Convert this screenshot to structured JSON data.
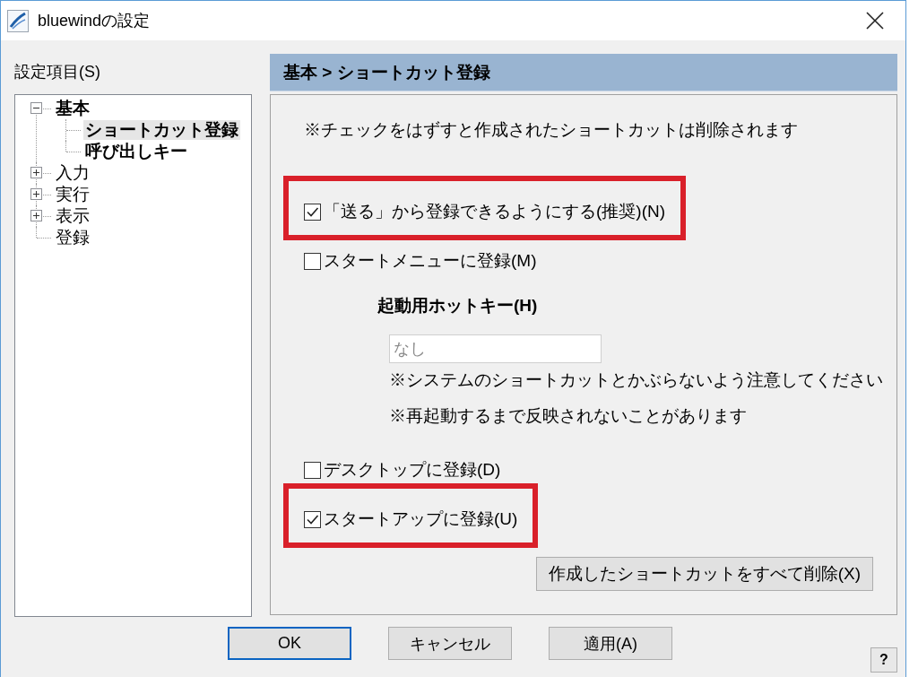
{
  "window": {
    "title": "bluewindの設定"
  },
  "sidebar": {
    "label": "設定項目(S)",
    "tree": [
      {
        "label": "基本",
        "expanded": true,
        "selected": false,
        "children": [
          {
            "label": "ショートカット登録",
            "selected": true
          },
          {
            "label": "呼び出しキー",
            "selected": false
          }
        ]
      },
      {
        "label": "入力",
        "expanded": false,
        "selected": false
      },
      {
        "label": "実行",
        "expanded": false,
        "selected": false
      },
      {
        "label": "表示",
        "expanded": false,
        "selected": false
      },
      {
        "label": "登録",
        "selected": false
      }
    ]
  },
  "panel": {
    "breadcrumb": "基本 > ショートカット登録",
    "notice": "※チェックをはずすと作成されたショートカットは削除されます",
    "controls": [
      {
        "kind": "checkbox",
        "label": "「送る」から登録できるようにする(推奨)(N)",
        "checked": true,
        "highlighted": true
      },
      {
        "kind": "checkbox",
        "label": "スタートメニューに登録(M)",
        "checked": false,
        "highlighted": false
      },
      {
        "kind": "hotkey",
        "heading": "起動用ホットキー(H)",
        "field": {
          "value": "なし",
          "disabled": true
        },
        "notes": [
          "※システムのショートカットとかぶらないよう注意してください",
          "※再起動するまで反映されないことがあります"
        ]
      },
      {
        "kind": "checkbox",
        "label": "デスクトップに登録(D)",
        "checked": false,
        "highlighted": false
      },
      {
        "kind": "checkbox",
        "label": "スタートアップに登録(U)",
        "checked": true,
        "highlighted": true
      }
    ],
    "delete_button": "作成したショートカットをすべて削除(X)"
  },
  "buttons": [
    {
      "label": "OK",
      "default": true
    },
    {
      "label": "キャンセル",
      "default": false
    },
    {
      "label": "適用(A)",
      "default": false
    }
  ],
  "help_button": "?"
}
